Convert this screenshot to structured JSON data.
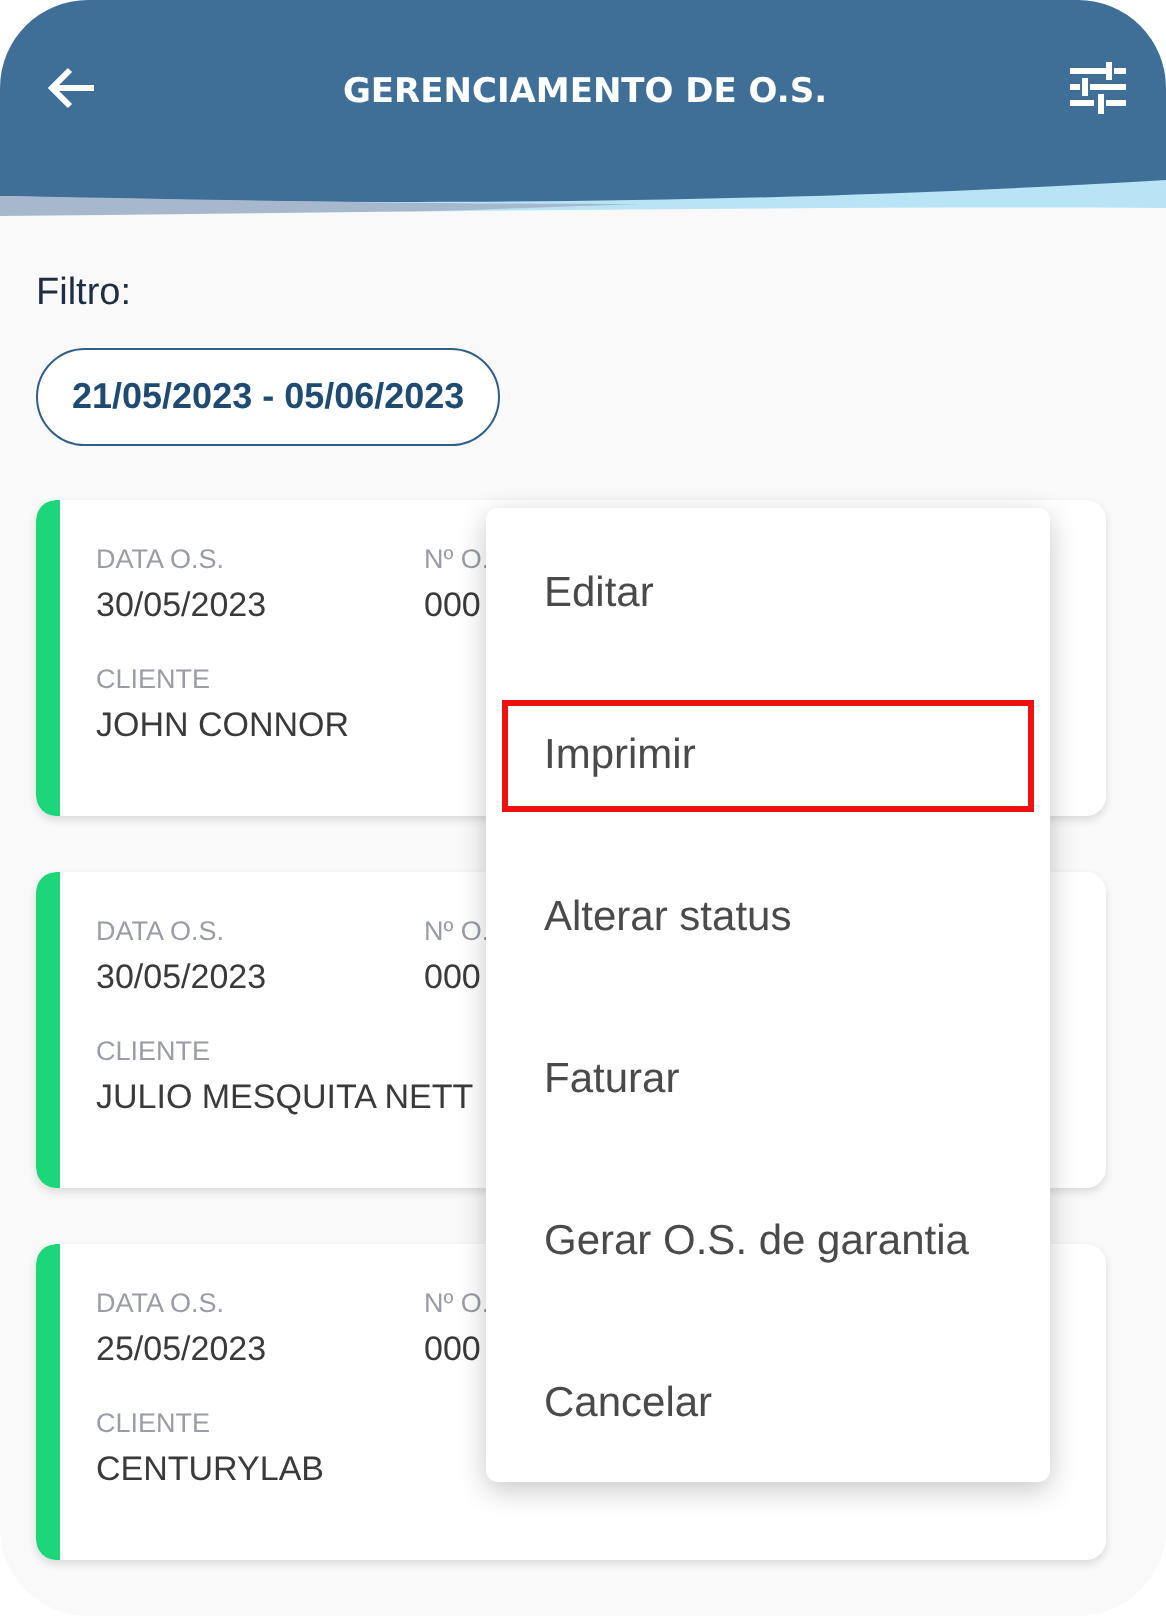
{
  "header": {
    "title": "GERENCIAMENTO DE O.S."
  },
  "filter": {
    "label": "Filtro:",
    "range": "21/05/2023 - 05/06/2023"
  },
  "orders": [
    {
      "date_label": "DATA O.S.",
      "date": "30/05/2023",
      "number_label": "Nº O.",
      "number": "000",
      "client_label": "CLIENTE",
      "client": "JOHN CONNOR",
      "color": "#1ed67a"
    },
    {
      "date_label": "DATA O.S.",
      "date": "30/05/2023",
      "number_label": "Nº O.",
      "number": "000",
      "client_label": "CLIENTE",
      "client": "JULIO MESQUITA NETT",
      "color": "#1ed67a"
    },
    {
      "date_label": "DATA O.S.",
      "date": "25/05/2023",
      "number_label": "Nº O.",
      "number": "000",
      "client_label": "CLIENTE",
      "client": "CENTURYLAB",
      "color": "#1ed67a"
    }
  ],
  "menu": [
    {
      "label": "Editar",
      "highlighted": false
    },
    {
      "label": "Imprimir",
      "highlighted": true
    },
    {
      "label": "Alterar status",
      "highlighted": false
    },
    {
      "label": "Faturar",
      "highlighted": false
    },
    {
      "label": "Gerar O.S. de garantia",
      "highlighted": false
    },
    {
      "label": "Cancelar",
      "highlighted": false
    }
  ]
}
